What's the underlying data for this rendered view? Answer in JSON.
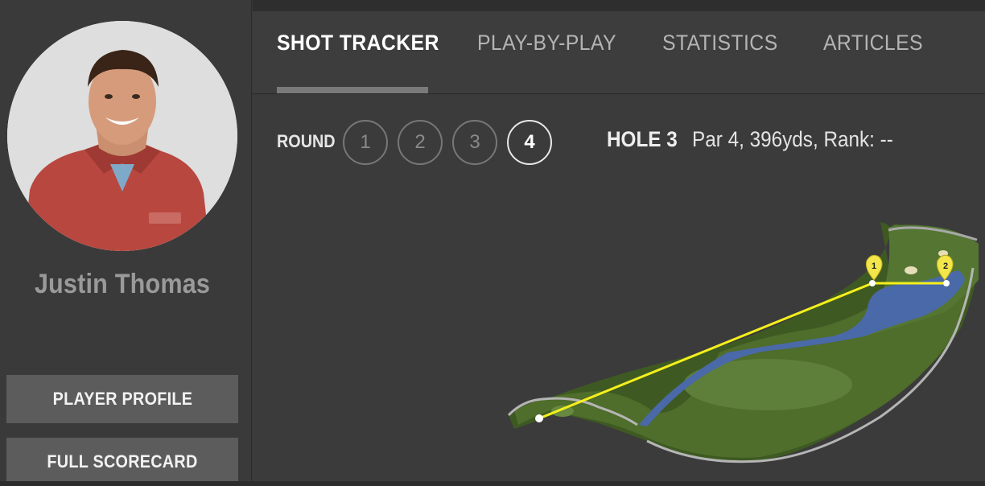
{
  "player": {
    "name": "Justin Thomas",
    "profile_button": "PLAYER PROFILE",
    "scorecard_button": "FULL SCORECARD"
  },
  "tabs": [
    {
      "label": "SHOT TRACKER",
      "active": true
    },
    {
      "label": "PLAY-BY-PLAY",
      "active": false
    },
    {
      "label": "STATISTICS",
      "active": false
    },
    {
      "label": "ARTICLES",
      "active": false
    }
  ],
  "round": {
    "label": "ROUND",
    "options": [
      "1",
      "2",
      "3",
      "4"
    ],
    "selected": "4"
  },
  "hole": {
    "label": "HOLE 3",
    "info": "Par 4, 396yds, Rank: --"
  },
  "shots": [
    {
      "number": "1"
    },
    {
      "number": "2"
    }
  ],
  "colors": {
    "background": "#3a3a3a",
    "fairway": "#4f6b2c",
    "rough": "#3f5a24",
    "water": "#4a6aa8",
    "shot_line": "#f5f01c",
    "marker": "#f2e64a"
  }
}
